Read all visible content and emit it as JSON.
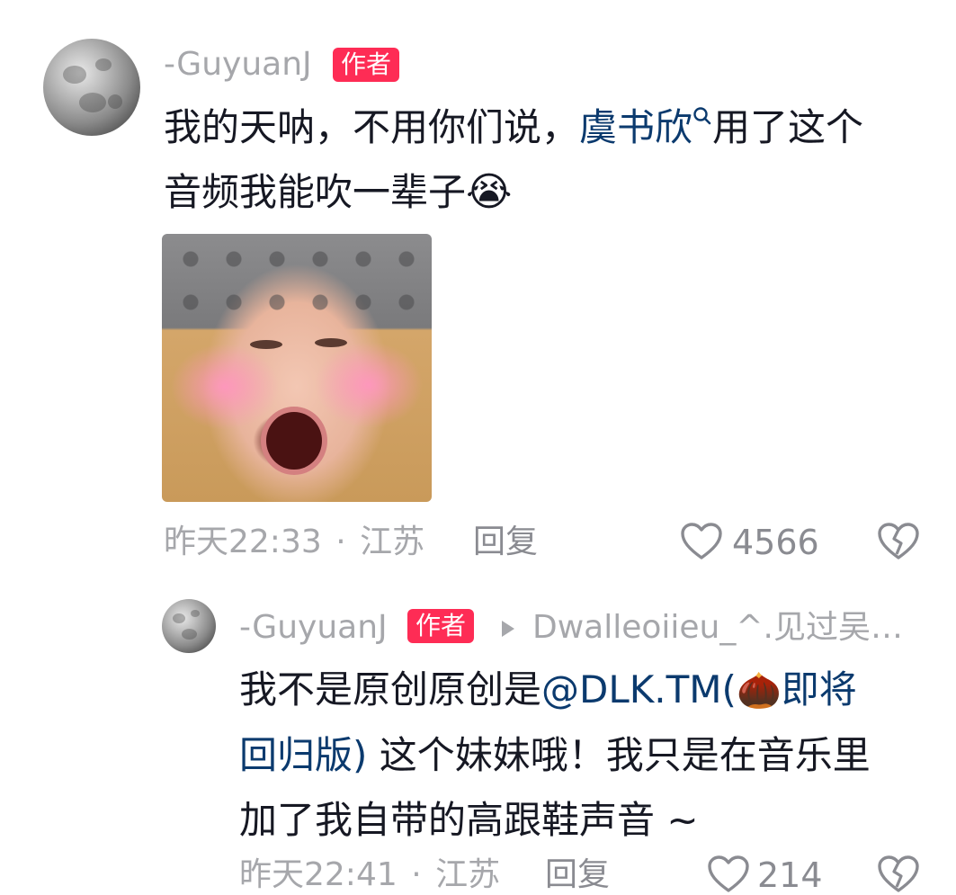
{
  "comment": {
    "username": "-GuyuanJ",
    "badge": "作者",
    "text_part1": "我的天呐，不用你们说，",
    "mention": "虞书欣",
    "text_part2": "用了这个",
    "text_line2": "音频我能吹一辈子",
    "emoji": "😭",
    "time": "昨天22:33",
    "separator": "·",
    "location": "江苏",
    "reply_label": "回复",
    "like_count": "4566"
  },
  "reply": {
    "username": "-GuyuanJ",
    "badge": "作者",
    "reply_to": "Dwalleoiieu_^.见过吴…",
    "text_line1_a": "我不是原创原创是",
    "mention_a": "@DLK.TM(",
    "mention_emoji": "🌰",
    "mention_b": "即将",
    "mention_line2": "回归版)",
    "text_line2": " 这个妹妹哦！我只是在音乐里",
    "text_line3": "加了我自带的高跟鞋声音 ~",
    "time": "昨天22:41",
    "separator": "·",
    "location": "江苏",
    "reply_label": "回复",
    "like_count": "214"
  },
  "colors": {
    "badge_bg": "#fe2c55",
    "link": "#0b3a6e",
    "muted": "#a6a7ab",
    "text": "#161823"
  },
  "icons": {
    "like": "heart-outline-icon",
    "dislike": "broken-heart-icon",
    "reply_arrow": "triangle-right-icon"
  }
}
